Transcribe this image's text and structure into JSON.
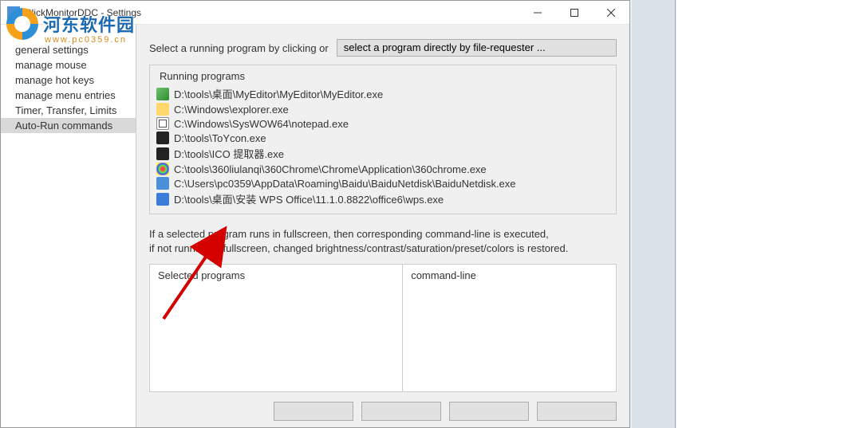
{
  "window": {
    "title": "ClickMonitorDDC - Settings"
  },
  "sidebar": {
    "items": [
      {
        "label": "general settings"
      },
      {
        "label": "manage mouse"
      },
      {
        "label": "manage hot keys"
      },
      {
        "label": "manage menu entries"
      },
      {
        "label": "Timer, Transfer, Limits"
      },
      {
        "label": "Auto-Run commands"
      }
    ],
    "active_index": 5
  },
  "toprow": {
    "label": "Select a running program by clicking or",
    "button_label": "select a program directly by file-requester ..."
  },
  "running_programs": {
    "legend": "Running programs",
    "items": [
      {
        "path": "D:\\tools\\桌面\\MyEditor\\MyEditor\\MyEditor.exe",
        "icon": "pi1"
      },
      {
        "path": "C:\\Windows\\explorer.exe",
        "icon": "pi2"
      },
      {
        "path": "C:\\Windows\\SysWOW64\\notepad.exe",
        "icon": "pi3"
      },
      {
        "path": "D:\\tools\\ToYcon.exe",
        "icon": "pi4"
      },
      {
        "path": "D:\\tools\\ICO 提取器.exe",
        "icon": "pi5"
      },
      {
        "path": "C:\\tools\\360liulanqi\\360Chrome\\Chrome\\Application\\360chrome.exe",
        "icon": "pi6"
      },
      {
        "path": "C:\\Users\\pc0359\\AppData\\Roaming\\Baidu\\BaiduNetdisk\\BaiduNetdisk.exe",
        "icon": "pi7"
      },
      {
        "path": "D:\\tools\\桌面\\安装 WPS Office\\11.1.0.8822\\office6\\wps.exe",
        "icon": "pi8"
      }
    ]
  },
  "info_text_line1": "If a selected program runs in fullscreen, then corresponding command-line is executed,",
  "info_text_line2": "if not running in fullscreen, changed brightness/contrast/saturation/preset/colors is restored.",
  "table": {
    "col1": "Selected programs",
    "col2": "command-line"
  },
  "logo": {
    "text": "河东软件园",
    "sub": "www.pc0359.cn"
  }
}
